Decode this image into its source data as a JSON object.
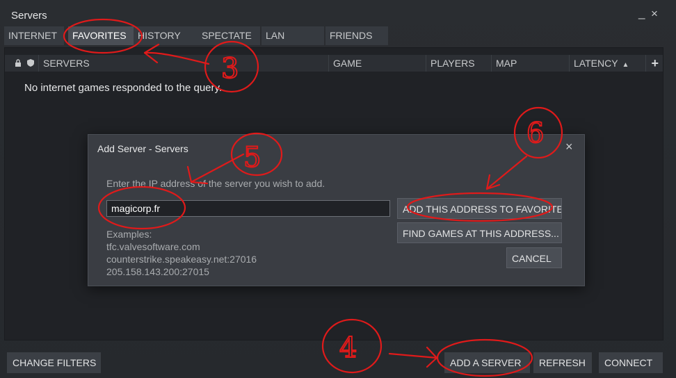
{
  "window": {
    "title": "Servers",
    "minimize": "_",
    "close": "×"
  },
  "tabs": [
    {
      "label": "INTERNET"
    },
    {
      "label": "FAVORITES"
    },
    {
      "label": "HISTORY"
    },
    {
      "label": "SPECTATE"
    },
    {
      "label": "LAN"
    },
    {
      "label": "FRIENDS"
    }
  ],
  "columns": {
    "servers": "SERVERS",
    "game": "GAME",
    "players": "PLAYERS",
    "map": "MAP",
    "latency": "LATENCY",
    "sort": "▲",
    "add": "+"
  },
  "empty_message": "No internet games responded to the query.",
  "dialog": {
    "title": "Add Server - Servers",
    "close": "×",
    "prompt": "Enter the IP address of the server you wish to add.",
    "ip_value": "magicorp.fr",
    "examples_label": "Examples:",
    "examples": [
      "tfc.valvesoftware.com",
      "counterstrike.speakeasy.net:27016",
      "205.158.143.200:27015"
    ],
    "add_button": "ADD THIS ADDRESS TO FAVORITES...",
    "find_button": "FIND GAMES AT THIS ADDRESS...",
    "cancel_button": "CANCEL"
  },
  "bottom": {
    "change_filters": "CHANGE FILTERS",
    "add_server": "ADD A SERVER",
    "refresh": "REFRESH",
    "connect": "CONNECT"
  },
  "annotations": [
    "3",
    "4",
    "5",
    "6"
  ]
}
